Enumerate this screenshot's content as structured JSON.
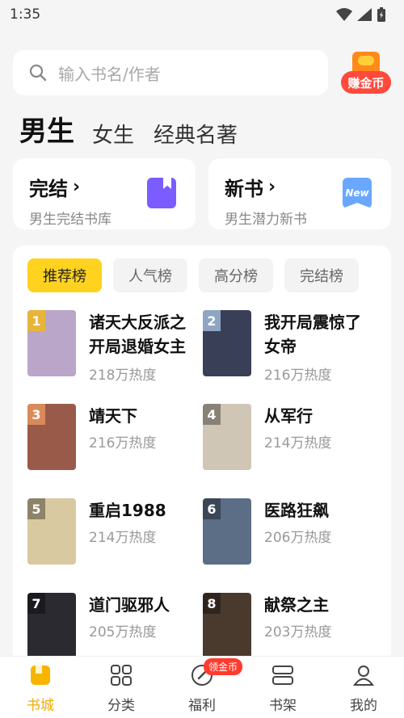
{
  "status": {
    "time": "1:35"
  },
  "search": {
    "placeholder": "输入书名/作者"
  },
  "earn_badge": {
    "label": "赚金币"
  },
  "gender_tabs": [
    {
      "label": "男生",
      "active": true
    },
    {
      "label": "女生",
      "active": false
    },
    {
      "label": "经典名著",
      "active": false
    }
  ],
  "category_cards": [
    {
      "title": "完结",
      "subtitle": "男生完结书库",
      "icon": "bookmark-book-icon"
    },
    {
      "title": "新书",
      "subtitle": "男生潜力新书",
      "icon": "new-badge-icon",
      "badge_text": "New"
    }
  ],
  "rank_tabs": [
    {
      "label": "推荐榜",
      "active": true
    },
    {
      "label": "人气榜",
      "active": false
    },
    {
      "label": "高分榜",
      "active": false
    },
    {
      "label": "完结榜",
      "active": false
    }
  ],
  "books": [
    {
      "rank": "1",
      "title": "诸天大反派之开局退婚女主",
      "heat": "218万热度",
      "cover_color": "#b9a6c9"
    },
    {
      "rank": "2",
      "title": "我开局震惊了女帝",
      "heat": "216万热度",
      "cover_color": "#3a3f58"
    },
    {
      "rank": "3",
      "title": "靖天下",
      "heat": "216万热度",
      "cover_color": "#9a5a4a"
    },
    {
      "rank": "4",
      "title": "从军行",
      "heat": "214万热度",
      "cover_color": "#cfc6b6"
    },
    {
      "rank": "5",
      "title": "重启1988",
      "heat": "214万热度",
      "cover_color": "#d9c9a0"
    },
    {
      "rank": "6",
      "title": "医路狂飙",
      "heat": "206万热度",
      "cover_color": "#5b6e86"
    },
    {
      "rank": "7",
      "title": "道门驱邪人",
      "heat": "205万热度",
      "cover_color": "#2a2a30"
    },
    {
      "rank": "8",
      "title": "献祭之主",
      "heat": "203万热度",
      "cover_color": "#4a3a2e"
    }
  ],
  "bottom_nav": [
    {
      "label": "书城",
      "icon": "book-city-icon",
      "active": true
    },
    {
      "label": "分类",
      "icon": "category-grid-icon",
      "active": false
    },
    {
      "label": "福利",
      "icon": "welfare-icon",
      "active": false,
      "badge": "领金币"
    },
    {
      "label": "书架",
      "icon": "bookshelf-icon",
      "active": false
    },
    {
      "label": "我的",
      "icon": "profile-icon",
      "active": false
    }
  ],
  "colors": {
    "accent": "#ffd21f",
    "active_nav": "#f4a900",
    "badge_red": "#ff3b30"
  }
}
